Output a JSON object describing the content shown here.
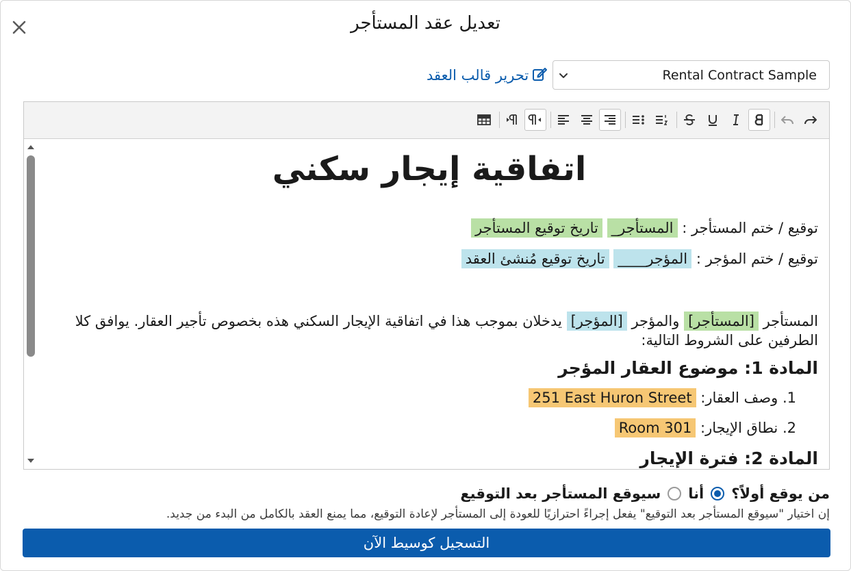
{
  "dialog": {
    "title": "تعديل عقد المستأجر"
  },
  "template": {
    "selected": "Rental Contract Sample",
    "edit_link": "تحرير قالب العقد"
  },
  "toolbar": {
    "buttons": [
      "table-icon",
      "ltr-icon",
      "rtl-icon",
      "align-left-icon",
      "align-center-icon",
      "align-right-icon",
      "bullet-list-icon",
      "numbered-list-icon",
      "strikethrough-icon",
      "underline-icon",
      "italic-icon",
      "bold-icon",
      "undo-icon",
      "redo-icon"
    ]
  },
  "document": {
    "title": "اتفاقية إيجار سكني",
    "tenant_sign": {
      "label": "توقيع / ختم المستأجر :",
      "field1": "المستأجر_",
      "field2": "تاريخ توقيع المستأجر"
    },
    "landlord_sign": {
      "label": "توقيع / ختم المؤجر :",
      "field1": "المؤجر____",
      "field2": "تاريخ توقيع مُنشئ العقد"
    },
    "intro": {
      "p1": "المستأجر",
      "tenant_tag": "[المستأجر]",
      "p2": "والمؤجر",
      "landlord_tag": "[المؤجر]",
      "p3": "يدخلان بموجب هذا في اتفاقية الإيجار السكني هذه بخصوص تأجير العقار. يوافق كلا الطرفين على الشروط التالية:"
    },
    "article1": {
      "heading": "المادة 1: موضوع العقار المؤجر",
      "item1_label": "1. وصف العقار:",
      "item1_value": "251 East Huron Street",
      "item2_label": "2. نطاق الإيجار:",
      "item2_value": "Room 301"
    },
    "article2": {
      "heading": "المادة 2: فترة الإيجار"
    }
  },
  "signing": {
    "question": "من يوقع أولاً؟",
    "option_me": "أنا",
    "option_tenant": "سيوقع المستأجر بعد التوقيع",
    "selected": "me",
    "help": "إن اختيار \"سيوقع المستأجر بعد التوقيع\" يفعل إجراءً احترازيًا للعودة إلى المستأجر لإعادة التوقيع، مما يمنع العقد بالكامل من البدء من جديد."
  },
  "submit": {
    "label": "التسجيل كوسيط الآن"
  },
  "colors": {
    "accent": "#0b5cad",
    "highlight_green": "#b9e0a5",
    "highlight_blue": "#bde3ec",
    "highlight_orange": "#f6c774"
  }
}
